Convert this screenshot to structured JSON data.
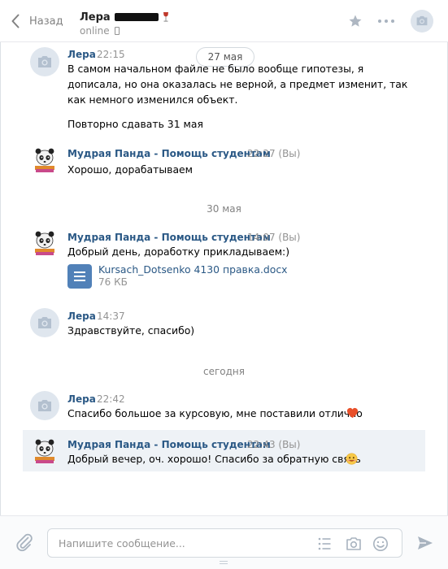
{
  "header": {
    "back_label": "Назад",
    "peer_name": "Лера",
    "peer_status": "online"
  },
  "dates": {
    "pill": "27 мая",
    "d2": "30 мая",
    "d3": "сегодня"
  },
  "messages": [
    {
      "author": "Лера",
      "time": "22:15",
      "lines": [
        "В самом начальном файле не было вообще гипотезы, я",
        "дописала, но она оказалась не верной, а предмет изменит, так",
        "как немного изменился объект.",
        "Повторно сдавать 31 мая"
      ]
    },
    {
      "author": "Мудрая Панда - Помощь студентам",
      "time": "22:27 (Вы)",
      "lines": [
        "Хорошо, дорабатываем"
      ]
    },
    {
      "author": "Мудрая Панда - Помощь студентам",
      "time": "14:07 (Вы)",
      "lines": [
        "Добрый день, доработку прикладываем:)"
      ],
      "attachment": {
        "name": "Kursach_Dotsenko 4130 правка.docx",
        "size": "76 КБ",
        "icon": "document-icon"
      }
    },
    {
      "author": "Лера",
      "time": "14:37",
      "lines": [
        "Здравствуйте, спасибо)"
      ]
    },
    {
      "author": "Лера",
      "time": "22:42",
      "lines": [
        "Спасибо большое за курсовую, мне поставили отлично"
      ],
      "emoji": "heart"
    },
    {
      "author": "Мудрая Панда - Помощь студентам",
      "time": "22:43 (Вы)",
      "lines": [
        "Добрый вечер, оч. хорошо! Спасибо за обратную связь"
      ],
      "emoji": "smile"
    }
  ],
  "composer": {
    "placeholder": "Напишите сообщение..."
  },
  "colors": {
    "link": "#2a5885",
    "accent": "#5181b8",
    "muted": "#939393",
    "highlight": "#eef2f6"
  }
}
